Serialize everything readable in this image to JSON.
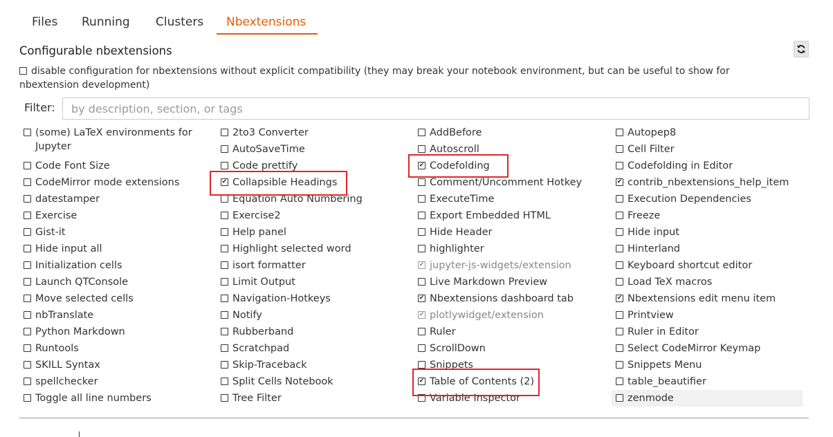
{
  "tabs": [
    {
      "label": "Files",
      "active": false
    },
    {
      "label": "Running",
      "active": false
    },
    {
      "label": "Clusters",
      "active": false
    },
    {
      "label": "Nbextensions",
      "active": true
    }
  ],
  "header": {
    "title": "Configurable nbextensions",
    "refresh_icon": "refresh-icon"
  },
  "compat": {
    "label": "disable configuration for nbextensions without explicit compatibility (they may break your notebook environment, but can be useful to show for nbextension development)",
    "checked": false
  },
  "filter": {
    "label": "Filter:",
    "placeholder": "by description, section, or tags",
    "value": ""
  },
  "columns": [
    [
      {
        "label": "(some) LaTeX environments for Jupyter",
        "checked": false
      },
      {
        "label": "Code Font Size",
        "checked": false
      },
      {
        "label": "CodeMirror mode extensions",
        "checked": false
      },
      {
        "label": "datestamper",
        "checked": false
      },
      {
        "label": "Exercise",
        "checked": false
      },
      {
        "label": "Gist-it",
        "checked": false
      },
      {
        "label": "Hide input all",
        "checked": false
      },
      {
        "label": "Initialization cells",
        "checked": false
      },
      {
        "label": "Launch QTConsole",
        "checked": false
      },
      {
        "label": "Move selected cells",
        "checked": false
      },
      {
        "label": "nbTranslate",
        "checked": false
      },
      {
        "label": "Python Markdown",
        "checked": false
      },
      {
        "label": "Runtools",
        "checked": false
      },
      {
        "label": "SKILL Syntax",
        "checked": false
      },
      {
        "label": "spellchecker",
        "checked": false
      },
      {
        "label": "Toggle all line numbers",
        "checked": false
      }
    ],
    [
      {
        "label": "2to3 Converter",
        "checked": false
      },
      {
        "label": "AutoSaveTime",
        "checked": false
      },
      {
        "label": "Code prettify",
        "checked": false
      },
      {
        "label": "Collapsible Headings",
        "checked": true
      },
      {
        "label": "Equation Auto Numbering",
        "checked": false
      },
      {
        "label": "Exercise2",
        "checked": false
      },
      {
        "label": "Help panel",
        "checked": false
      },
      {
        "label": "Highlight selected word",
        "checked": false
      },
      {
        "label": "isort formatter",
        "checked": false
      },
      {
        "label": "Limit Output",
        "checked": false
      },
      {
        "label": "Navigation-Hotkeys",
        "checked": false
      },
      {
        "label": "Notify",
        "checked": false
      },
      {
        "label": "Rubberband",
        "checked": false
      },
      {
        "label": "Scratchpad",
        "checked": false
      },
      {
        "label": "Skip-Traceback",
        "checked": false
      },
      {
        "label": "Split Cells Notebook",
        "checked": false
      },
      {
        "label": "Tree Filter",
        "checked": false
      }
    ],
    [
      {
        "label": "AddBefore",
        "checked": false
      },
      {
        "label": "Autoscroll",
        "checked": false
      },
      {
        "label": "Codefolding",
        "checked": true
      },
      {
        "label": "Comment/Uncomment Hotkey",
        "checked": false
      },
      {
        "label": "ExecuteTime",
        "checked": false
      },
      {
        "label": "Export Embedded HTML",
        "checked": false
      },
      {
        "label": "Hide Header",
        "checked": false
      },
      {
        "label": "highlighter",
        "checked": false
      },
      {
        "label": "jupyter-js-widgets/extension",
        "checked": true,
        "disabled": true
      },
      {
        "label": "Live Markdown Preview",
        "checked": false
      },
      {
        "label": "Nbextensions dashboard tab",
        "checked": true
      },
      {
        "label": "plotlywidget/extension",
        "checked": true,
        "disabled": true
      },
      {
        "label": "Ruler",
        "checked": false
      },
      {
        "label": "ScrollDown",
        "checked": false
      },
      {
        "label": "Snippets",
        "checked": false
      },
      {
        "label": "Table of Contents (2)",
        "checked": true
      },
      {
        "label": "Variable Inspector",
        "checked": false
      }
    ],
    [
      {
        "label": "Autopep8",
        "checked": false
      },
      {
        "label": "Cell Filter",
        "checked": false
      },
      {
        "label": "Codefolding in Editor",
        "checked": false
      },
      {
        "label": "contrib_nbextensions_help_item",
        "checked": true
      },
      {
        "label": "Execution Dependencies",
        "checked": false
      },
      {
        "label": "Freeze",
        "checked": false
      },
      {
        "label": "Hide input",
        "checked": false
      },
      {
        "label": "Hinterland",
        "checked": false
      },
      {
        "label": "Keyboard shortcut editor",
        "checked": false
      },
      {
        "label": "Load TeX macros",
        "checked": false
      },
      {
        "label": "Nbextensions edit menu item",
        "checked": true
      },
      {
        "label": "Printview",
        "checked": false
      },
      {
        "label": "Ruler in Editor",
        "checked": false
      },
      {
        "label": "Select CodeMirror Keymap",
        "checked": false
      },
      {
        "label": "Snippets Menu",
        "checked": false
      },
      {
        "label": "table_beautifier",
        "checked": false
      },
      {
        "label": "zenmode",
        "checked": false,
        "hover": true
      }
    ]
  ],
  "highlight_color": "#e0242a",
  "accent_color": "#e65c00"
}
